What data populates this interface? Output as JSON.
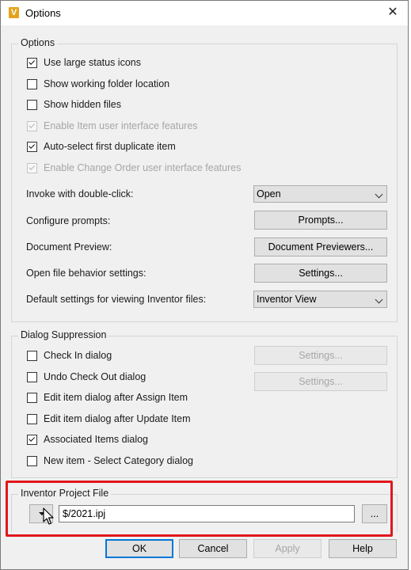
{
  "window": {
    "title": "Options",
    "app_icon_letter": "V",
    "close_glyph": "✕"
  },
  "options_group": {
    "title": "Options",
    "checkboxes": [
      {
        "label": "Use large status icons",
        "checked": true,
        "enabled": true
      },
      {
        "label": "Show working folder location",
        "checked": false,
        "enabled": true
      },
      {
        "label": "Show hidden files",
        "checked": false,
        "enabled": true
      },
      {
        "label": "Enable Item user interface features",
        "checked": true,
        "enabled": false
      },
      {
        "label": "Auto-select first duplicate item",
        "checked": true,
        "enabled": true
      },
      {
        "label": "Enable Change Order user interface features",
        "checked": true,
        "enabled": false
      }
    ],
    "invoke_label": "Invoke with double-click:",
    "invoke_value": "Open",
    "prompts_label": "Configure prompts:",
    "prompts_button": "Prompts...",
    "preview_label": "Document Preview:",
    "preview_button": "Document Previewers...",
    "open_behavior_label": "Open file behavior settings:",
    "open_behavior_button": "Settings...",
    "viewing_label": "Default settings for viewing Inventor files:",
    "viewing_value": "Inventor View"
  },
  "dialog_suppression": {
    "title": "Dialog Suppression",
    "checkboxes": [
      {
        "label": "Check In dialog",
        "checked": false
      },
      {
        "label": "Undo Check Out dialog",
        "checked": false
      },
      {
        "label": "Edit item dialog after Assign Item",
        "checked": false
      },
      {
        "label": "Edit item dialog after Update Item",
        "checked": false
      },
      {
        "label": "Associated Items dialog",
        "checked": true
      },
      {
        "label": "New item - Select Category dialog",
        "checked": false
      }
    ],
    "settings_button_1": "Settings...",
    "settings_button_2": "Settings..."
  },
  "project_file": {
    "title": "Inventor Project File",
    "value": "$/2021.ipj",
    "browse_label": "..."
  },
  "footer": {
    "ok": "OK",
    "cancel": "Cancel",
    "apply": "Apply",
    "help": "Help"
  },
  "colors": {
    "highlight": "#e0161c",
    "accent": "#0078d7",
    "app_icon": "#e6a21a"
  }
}
